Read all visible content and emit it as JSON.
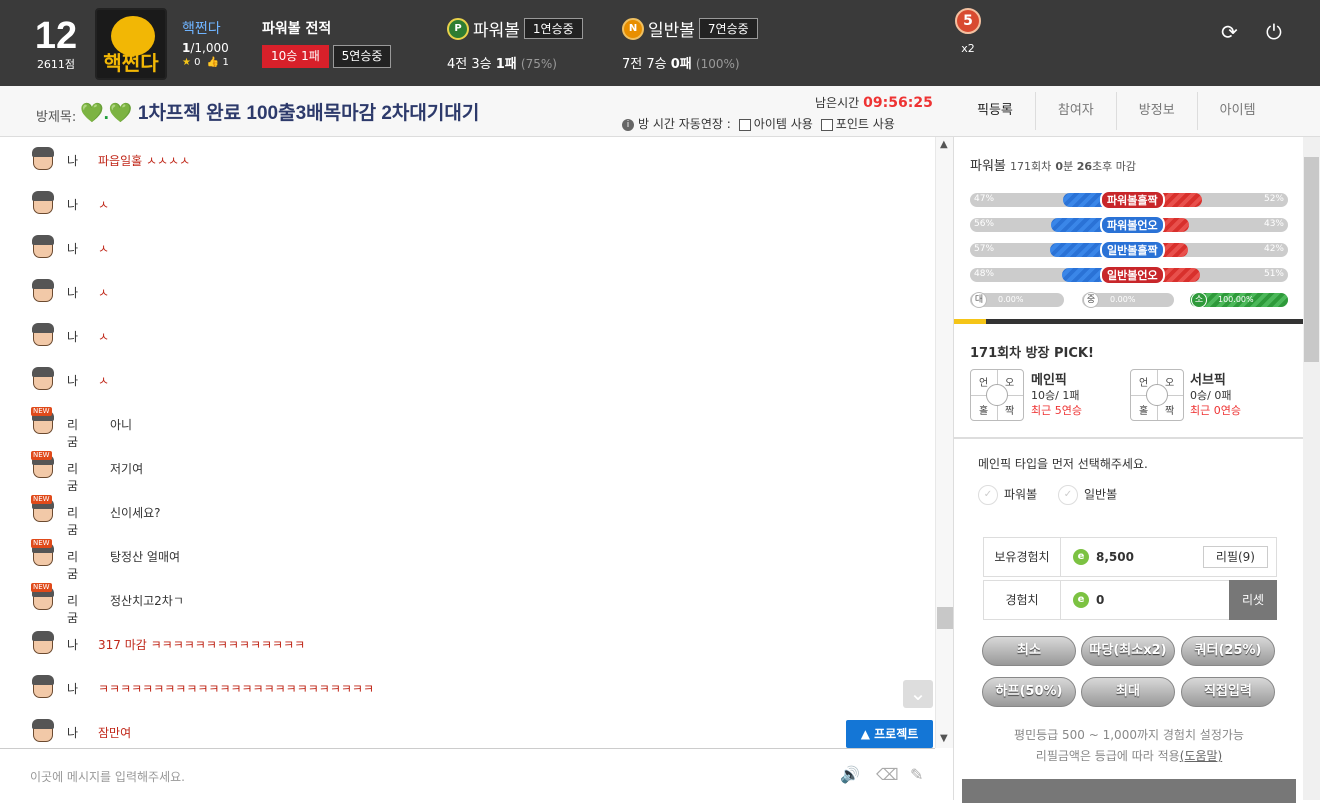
{
  "host": {
    "level": "12",
    "points": "2611점",
    "room_image_text": "핵쩐다",
    "name": "핵쩐다",
    "count_bold": "1",
    "count_rest": "/1,000",
    "stars": "0",
    "likes": "1"
  },
  "record": {
    "title": "파워볼 전적",
    "win_loss": "10승 1패",
    "streak": "5연승중"
  },
  "powerball": {
    "coin": "P",
    "label": "파워볼",
    "streak": "1연승중",
    "rec_pre": "4전 3승 ",
    "rec_bold": "1패",
    "pct": "(75%)"
  },
  "normalball": {
    "coin": "N",
    "label": "일반볼",
    "streak": "7연승중",
    "rec_pre": "7전 7승 ",
    "rec_bold": "0패",
    "pct": "(100%)"
  },
  "medal": {
    "num": "5",
    "mult": "x2"
  },
  "icons": {
    "refresh": "refresh-icon",
    "power": "power-icon"
  },
  "room": {
    "label": "방제목:",
    "hearts": "💚.💚",
    "title": "1차프젝 완료 100출3배목마감 2차대기대기",
    "remain_label": "남은시간",
    "remain_time": "09:56:25",
    "auto_extend": "방 시간 자동연장 :",
    "opt_item": "아이템 사용",
    "opt_point": "포인트 사용"
  },
  "tabs": [
    "픽등록",
    "참여자",
    "방정보",
    "아이템"
  ],
  "chat": [
    {
      "name": "나",
      "msg": "파읍일홀 ㅅㅅㅅㅅ",
      "style": "red",
      "new": false
    },
    {
      "name": "나",
      "msg": "ㅅ",
      "style": "red",
      "new": false
    },
    {
      "name": "나",
      "msg": "ㅅ",
      "style": "red",
      "new": false
    },
    {
      "name": "나",
      "msg": "ㅅ",
      "style": "red",
      "new": false
    },
    {
      "name": "나",
      "msg": "ㅅ",
      "style": "red",
      "new": false
    },
    {
      "name": "나",
      "msg": "ㅅ",
      "style": "red",
      "new": false
    },
    {
      "name": "리굼",
      "msg": "아니",
      "style": "gray",
      "new": true
    },
    {
      "name": "리굼",
      "msg": "저기여",
      "style": "gray",
      "new": true
    },
    {
      "name": "리굼",
      "msg": "신이세요?",
      "style": "gray",
      "new": true
    },
    {
      "name": "리굼",
      "msg": "탕정산 얼매여",
      "style": "gray",
      "new": true
    },
    {
      "name": "리굼",
      "msg": "정산치고2차ㄱ",
      "style": "gray",
      "new": true
    },
    {
      "name": "나",
      "msg": "317 마감 ㅋㅋㅋㅋㅋㅋㅋㅋㅋㅋㅋㅋㅋㅋ",
      "style": "red",
      "new": false
    },
    {
      "name": "나",
      "msg": "ㅋㅋㅋㅋㅋㅋㅋㅋㅋㅋㅋㅋㅋㅋㅋㅋㅋㅋㅋㅋㅋㅋㅋㅋㅋ",
      "style": "red",
      "new": false
    },
    {
      "name": "나",
      "msg": "잠만여",
      "style": "red",
      "new": false
    }
  ],
  "new_badge": "NEW",
  "project_button": "▲ 프로젝트",
  "input_placeholder": "이곳에 메시지를 입력해주세요.",
  "side": {
    "game": "파워볼",
    "round": "171회차",
    "time_bold1": "0",
    "time_u1": "분",
    "time_bold2": "26",
    "time_u2": "초후 마감",
    "bars": [
      {
        "left": "47%",
        "right": "52%",
        "center": "파워볼홀짝",
        "center_color": "red",
        "blue_pct": 47,
        "red_pct": 52
      },
      {
        "left": "56%",
        "right": "43%",
        "center": "파워볼언오",
        "center_color": "blue",
        "blue_pct": 56,
        "red_pct": 43
      },
      {
        "left": "57%",
        "right": "42%",
        "center": "일반볼홀짝",
        "center_color": "blue",
        "blue_pct": 57,
        "red_pct": 42
      },
      {
        "left": "48%",
        "right": "51%",
        "center": "일반볼언오",
        "center_color": "red",
        "blue_pct": 48,
        "red_pct": 51
      }
    ],
    "size": [
      {
        "key": "대",
        "val": "0.00%"
      },
      {
        "key": "중",
        "val": "0.00%"
      },
      {
        "key": "소",
        "val": "100.00%"
      }
    ],
    "progress": 0.09,
    "pick_title": "171회차 방장 PICK!",
    "grid": [
      "언",
      "오",
      "홀",
      "짝"
    ],
    "main": {
      "title": "메인픽",
      "rec": "10승/ 1패",
      "streak": "최근 5연승"
    },
    "sub": {
      "title": "서브픽",
      "rec": "0승/ 0패",
      "streak": "최근 0연승"
    },
    "hint": "메인픽 타입을 먼저 선택해주세요.",
    "radio1": "파워볼",
    "radio2": "일반볼",
    "owned_label": "보유경험치",
    "owned_val": "8,500",
    "refill": "리필(9)",
    "exp_label": "경험치",
    "exp_val": "0",
    "reset": "리셋",
    "e_icon": "e",
    "buttons": [
      "최소",
      "따당(최소x2)",
      "쿼터(25%)",
      "하프(50%)",
      "최대",
      "직접입력"
    ],
    "note1": "평민등급 500 ~ 1,000까지 경험치 설정가능",
    "note2_pre": "리필금액은 등급에 따라 적용",
    "note2_link": "(도움말)"
  }
}
